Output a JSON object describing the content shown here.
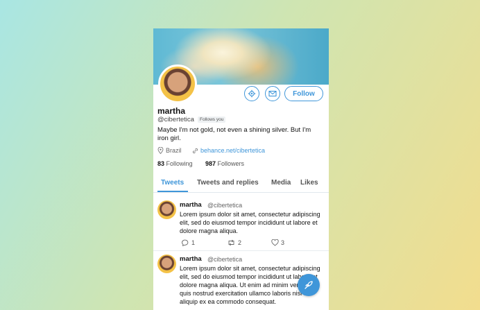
{
  "colors": {
    "accent": "#3f96d9",
    "text": "#111111",
    "muted": "#666666"
  },
  "profile": {
    "name": "martha",
    "handle": "@cibertetica",
    "follows_badge": "Follows you",
    "bio": "Maybe I'm not gold, not even a shining silver. But I'm iron girl.",
    "location": "Brazil",
    "website": "behance.net/cibertetica",
    "following_count": "83",
    "following_label": "Following",
    "followers_count": "987",
    "followers_label": "Followers"
  },
  "actions": {
    "settings_icon": "gear-icon",
    "message_icon": "envelope-icon",
    "follow_label": "Follow"
  },
  "tabs": [
    {
      "label": "Tweets",
      "active": true
    },
    {
      "label": "Tweets and replies",
      "active": false
    },
    {
      "label": "Media",
      "active": false
    },
    {
      "label": "Likes",
      "active": false
    }
  ],
  "tweets": [
    {
      "name": "martha",
      "handle": "@cibertetica",
      "text": "Lorem ipsum dolor sit amet, consectetur adipiscing elit, sed do eiusmod tempor incididunt ut labore et dolore magna aliqua.",
      "replies": "1",
      "retweets": "2",
      "likes": "3"
    },
    {
      "name": "martha",
      "handle": "@cibertetica",
      "text": "Lorem ipsum dolor sit amet, consectetur adipiscing elit, sed do eiusmod tempor incididunt ut labore et dolore magna aliqua. Ut enim ad minim veniam, quis nostrud exercitation ullamco laboris nisi ut aliquip ex ea commodo consequat."
    }
  ],
  "compose": {
    "icon": "compose-feather-icon"
  }
}
